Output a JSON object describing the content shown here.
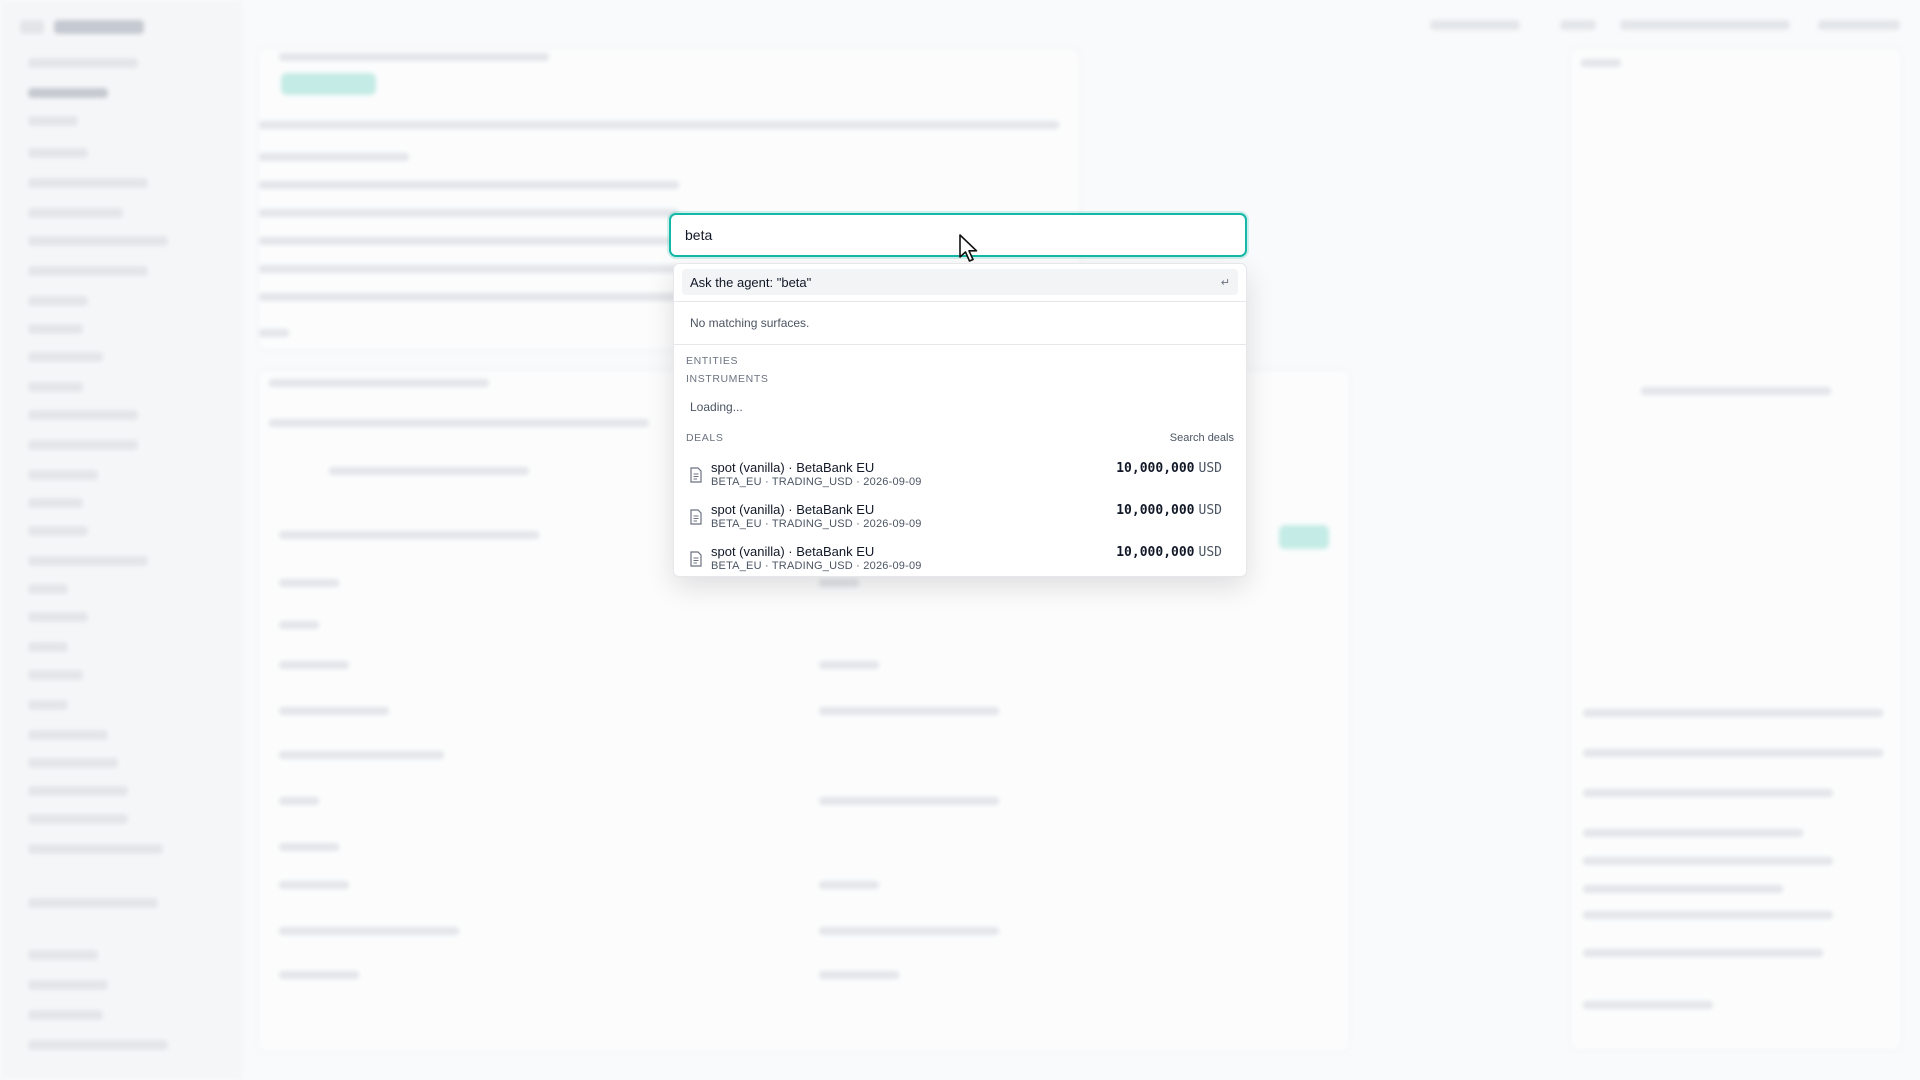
{
  "search": {
    "query": "beta"
  },
  "palette": {
    "ask_agent_label": "Ask the agent: \"beta\"",
    "enter_hint": "↵",
    "no_surfaces_text": "No matching surfaces.",
    "entities_label": "ENTITIES",
    "instruments_label": "INSTRUMENTS",
    "loading_text": "Loading...",
    "deals_label": "DEALS",
    "search_deals_label": "Search deals",
    "deals": [
      {
        "title": "spot (vanilla) · BetaBank EU",
        "subtitle": "BETA_EU · TRADING_USD · 2026-09-09",
        "amount": "10,000,000",
        "currency": "USD",
        "icon": "document-icon"
      },
      {
        "title": "spot (vanilla) · BetaBank EU",
        "subtitle": "BETA_EU · TRADING_USD · 2026-09-09",
        "amount": "10,000,000",
        "currency": "USD",
        "icon": "document-icon"
      },
      {
        "title": "spot (vanilla) · BetaBank EU",
        "subtitle": "BETA_EU · TRADING_USD · 2026-09-09",
        "amount": "10,000,000",
        "currency": "USD",
        "icon": "document-icon"
      }
    ]
  },
  "colors": {
    "accent": "#14b8a6",
    "highlight_row": "#f3f4f6"
  }
}
